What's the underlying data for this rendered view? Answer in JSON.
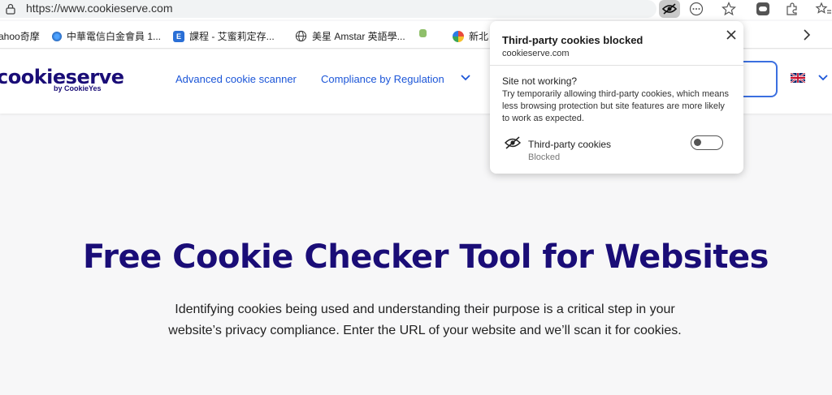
{
  "browser": {
    "url": "https://www.cookieserve.com",
    "bookmarks": [
      {
        "label": "ahoo奇摩",
        "icon": "yahoo-icon"
      },
      {
        "label": "中華電信白金會員 1...",
        "icon": "cht-icon"
      },
      {
        "label": "課程 - 艾蜜莉定存...",
        "icon": "course-icon"
      },
      {
        "label": "美星 Amstar 英語學...",
        "icon": "globe-icon"
      },
      {
        "label": "",
        "icon": "bookmark-green-icon"
      },
      {
        "label": "新北",
        "icon": "newtaipei-icon"
      }
    ]
  },
  "site": {
    "logo_main": "cookie",
    "logo_accent": "serve",
    "logo_sub": "by CookieYes",
    "nav": {
      "scanner": "Advanced cookie scanner",
      "compliance": "Compliance by Regulation"
    },
    "hero": {
      "title": "Free Cookie Checker Tool for Websites",
      "description": "Identifying cookies being used and understanding their purpose is a critical step in your website’s privacy compliance. Enter the URL of your website and we’ll scan it for cookies."
    }
  },
  "popup": {
    "title": "Third-party cookies blocked",
    "domain": "cookieserve.com",
    "question": "Site not working?",
    "description": "Try temporarily allowing third-party cookies, which means less browsing protection but site features are more likely to work as expected.",
    "row_label": "Third-party cookies",
    "row_status": "Blocked",
    "toggle_on": false
  },
  "colors": {
    "brand": "#1a0d77",
    "link": "#1c56d8",
    "accent_border": "#3b6fe0"
  }
}
